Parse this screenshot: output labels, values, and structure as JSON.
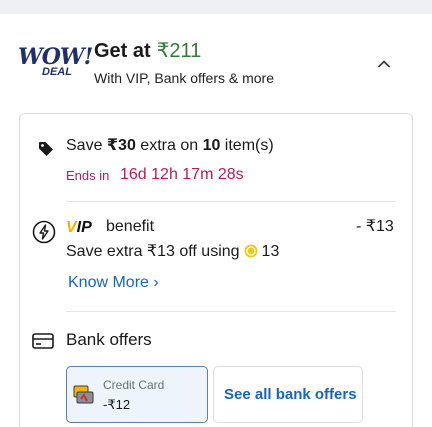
{
  "header": {
    "logo_top": "WOW!",
    "logo_bottom": "DEAL",
    "title_prefix": "Get at",
    "price": "₹211",
    "subtitle": "With VIP, Bank offers & more"
  },
  "save_offer": {
    "prefix": "Save ",
    "amount": "₹30",
    "middle": " extra on ",
    "count": "10",
    "suffix": " item(s)",
    "ends_label": "Ends in",
    "ends_time": "16d 12h 17m 28s"
  },
  "vip": {
    "badge_v": "V",
    "badge_rest": "IP",
    "label": "benefit",
    "amount": "- ₹13",
    "desc_text": "Save extra ₹13 off using",
    "coins": "13",
    "know_more": "Know More ›"
  },
  "bank": {
    "title": "Bank offers",
    "card_label": "Credit Card",
    "card_amount": "-₹12",
    "see_all": "See all bank offers"
  },
  "colors": {
    "price_green": "#2e7d32",
    "timer_pink": "#c2185b",
    "link_blue": "#1565c0",
    "vip_gold": "#f3b400",
    "logo_navy": "#1f2f6b"
  }
}
